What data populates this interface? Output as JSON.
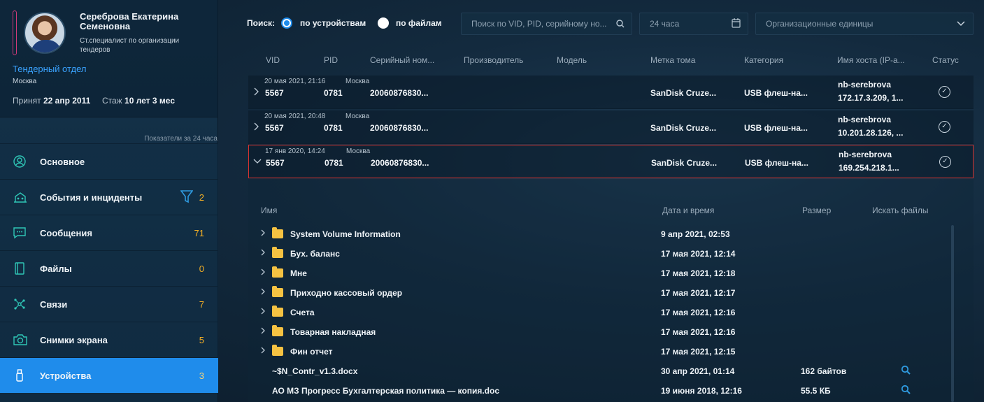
{
  "profile": {
    "name": "Сереброва Екатерина Семеновна",
    "role": "Ст.специалист по организации тендеров",
    "department": "Тендерный отдел",
    "city": "Москва",
    "hired_label": "Принят",
    "hired_date": "22 апр 2011",
    "tenure_label": "Стаж",
    "tenure_value": "10 лет 3 мес"
  },
  "period_note": "Показатели за 24 часа",
  "nav": [
    {
      "label": "Основное",
      "count": "",
      "icon": "user-circle-icon"
    },
    {
      "label": "События и инциденты",
      "count": "2",
      "icon": "events-icon"
    },
    {
      "label": "Сообщения",
      "count": "71",
      "icon": "chat-icon"
    },
    {
      "label": "Файлы",
      "count": "0",
      "icon": "file-icon"
    },
    {
      "label": "Связи",
      "count": "7",
      "icon": "network-icon"
    },
    {
      "label": "Снимки экрана",
      "count": "5",
      "icon": "camera-icon"
    },
    {
      "label": "Устройства",
      "count": "3",
      "icon": "usb-icon"
    }
  ],
  "search": {
    "label": "Поиск:",
    "option_devices": "по устройствам",
    "option_files": "по файлам",
    "placeholder": "Поиск по VID, PID, серийному но...",
    "period": "24 часа",
    "org_units": "Организационные единицы"
  },
  "table": {
    "headers": [
      "VID",
      "PID",
      "Серийный ном...",
      "Производитель",
      "Модель",
      "Метка тома",
      "Категория",
      "Имя хоста (IP-а...",
      "Статус"
    ],
    "rows": [
      {
        "date": "20 мая 2021, 21:16",
        "city": "Москва",
        "vid": "5567",
        "pid": "0781",
        "serial": "20060876830...",
        "label": "SanDisk Cruze...",
        "category": "USB флеш-на...",
        "host": "nb-serebrova",
        "ip": "172.17.3.209, 1..."
      },
      {
        "date": "20 мая 2021, 20:48",
        "city": "Москва",
        "vid": "5567",
        "pid": "0781",
        "serial": "20060876830...",
        "label": "SanDisk Cruze...",
        "category": "USB флеш-на...",
        "host": "nb-serebrova",
        "ip": "10.201.28.126, ..."
      },
      {
        "date": "17 янв 2020, 14:24",
        "city": "Москва",
        "vid": "5567",
        "pid": "0781",
        "serial": "20060876830...",
        "label": "SanDisk Cruze...",
        "category": "USB флеш-на...",
        "host": "nb-serebrova",
        "ip": "169.254.218.1..."
      }
    ]
  },
  "files": {
    "headers": {
      "name": "Имя",
      "date": "Дата и время",
      "size": "Размер",
      "search": "Искать файлы"
    },
    "items": [
      {
        "name": "System Volume Information",
        "date": "9 апр 2021, 02:53",
        "size": "",
        "folder": true
      },
      {
        "name": "Бух. баланс",
        "date": "17 мая 2021, 12:14",
        "size": "",
        "folder": true
      },
      {
        "name": "Мне",
        "date": "17 мая 2021, 12:18",
        "size": "",
        "folder": true
      },
      {
        "name": "Приходно кассовый ордер",
        "date": "17 мая 2021, 12:17",
        "size": "",
        "folder": true
      },
      {
        "name": "Счета",
        "date": "17 мая 2021, 12:16",
        "size": "",
        "folder": true
      },
      {
        "name": "Товарная накладная",
        "date": "17 мая 2021, 12:16",
        "size": "",
        "folder": true
      },
      {
        "name": "Фин отчет",
        "date": "17 мая 2021, 12:15",
        "size": "",
        "folder": true
      },
      {
        "name": "~$N_Contr_v1.3.docx",
        "date": "30 апр 2021, 01:14",
        "size": "162 байтов",
        "folder": false
      },
      {
        "name": "АО МЗ Прогресс Бухгалтерская политика — копия.doc",
        "date": "19 июня 2018, 12:16",
        "size": "55.5 КБ",
        "folder": false
      }
    ]
  },
  "colors": {
    "accent": "#1f8ceb",
    "count": "#f5b025",
    "selected_border": "#d8332f",
    "folder": "#f5c242"
  }
}
